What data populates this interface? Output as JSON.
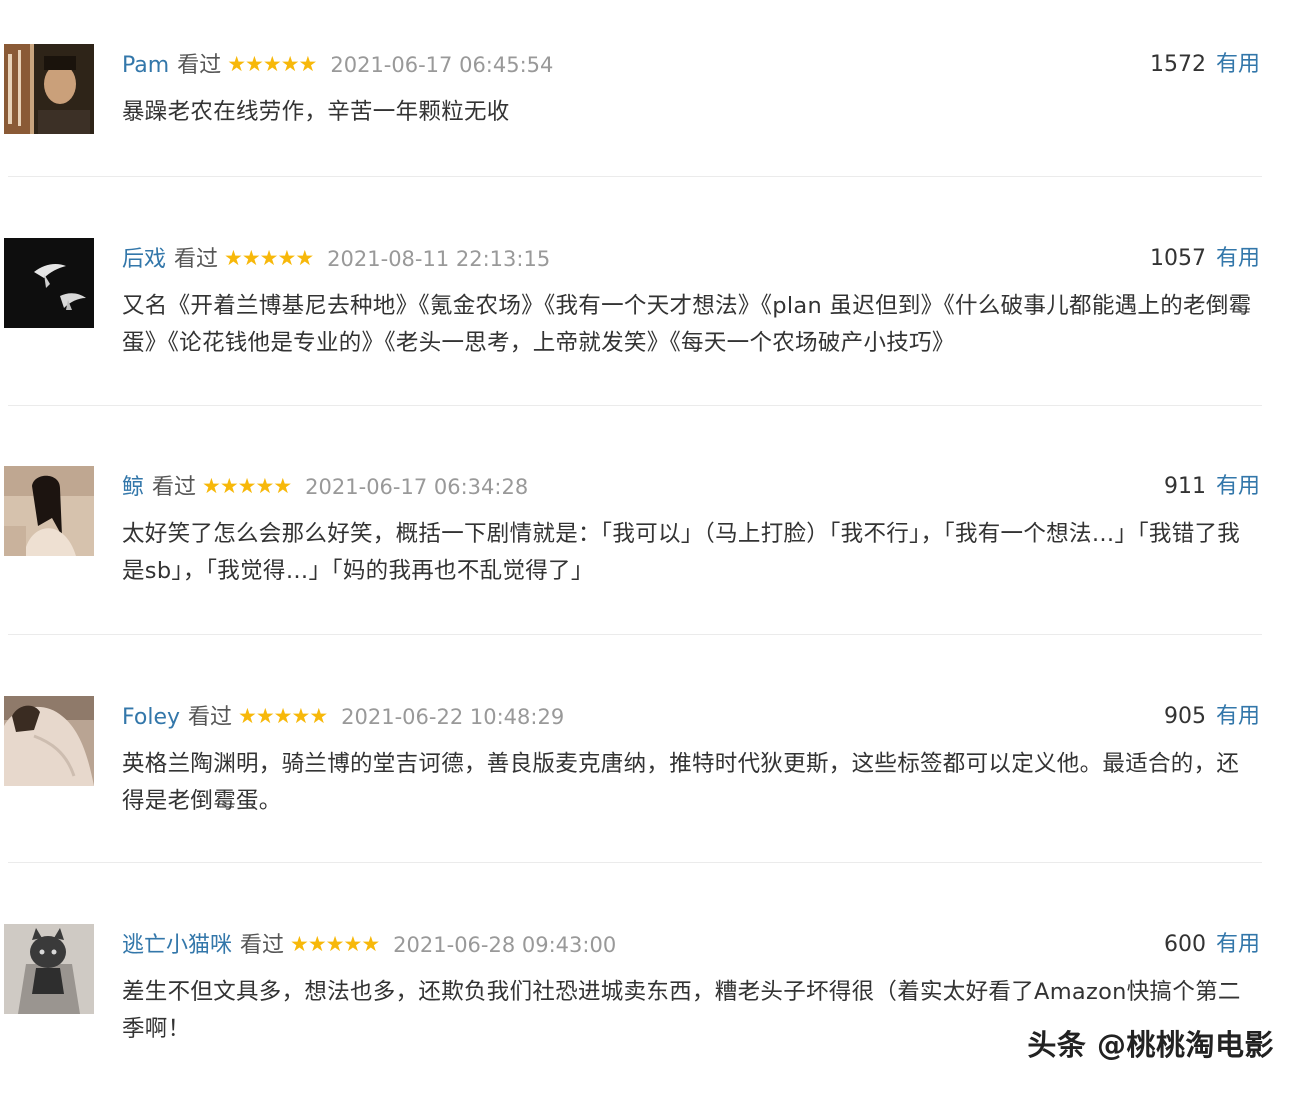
{
  "reviews": [
    {
      "user": "Pam",
      "status": "看过",
      "stars": "★★★★★",
      "time": "2021-06-17 06:45:54",
      "votes": "1572",
      "useful_label": "有用",
      "comment": "暴躁老农在线劳作，辛苦一年颗粒无收"
    },
    {
      "user": "后戏",
      "status": "看过",
      "stars": "★★★★★",
      "time": "2021-08-11 22:13:15",
      "votes": "1057",
      "useful_label": "有用",
      "comment": "又名《开着兰博基尼去种地》《氪金农场》《我有一个天才想法》《plan 虽迟但到》《什么破事儿都能遇上的老倒霉蛋》《论花钱他是专业的》《老头一思考，上帝就发笑》《每天一个农场破产小技巧》"
    },
    {
      "user": "鲸",
      "status": "看过",
      "stars": "★★★★★",
      "time": "2021-06-17 06:34:28",
      "votes": "911",
      "useful_label": "有用",
      "comment": "太好笑了怎么会那么好笑，概括一下剧情就是：「我可以」（马上打脸）「我不行」，「我有一个想法…」「我错了我是sb」，「我觉得…」「妈的我再也不乱觉得了」"
    },
    {
      "user": "Foley",
      "status": "看过",
      "stars": "★★★★★",
      "time": "2021-06-22 10:48:29",
      "votes": "905",
      "useful_label": "有用",
      "comment": "英格兰陶渊明，骑兰博的堂吉诃德，善良版麦克唐纳，推特时代狄更斯，这些标签都可以定义他。最适合的，还得是老倒霉蛋。"
    },
    {
      "user": "逃亡小猫咪",
      "status": "看过",
      "stars": "★★★★★",
      "time": "2021-06-28 09:43:00",
      "votes": "600",
      "useful_label": "有用",
      "comment": "差生不但文具多，想法也多，还欺负我们社恐进城卖东西，糟老头子坏得很（着实太好看了Amazon快搞个第二季啊！"
    }
  ],
  "watermark": "头条 @桃桃淘电影",
  "colors": {
    "link": "#3377aa",
    "star": "#f7b80a",
    "time": "#999999",
    "text": "#333333",
    "divider": "#ebebeb"
  }
}
